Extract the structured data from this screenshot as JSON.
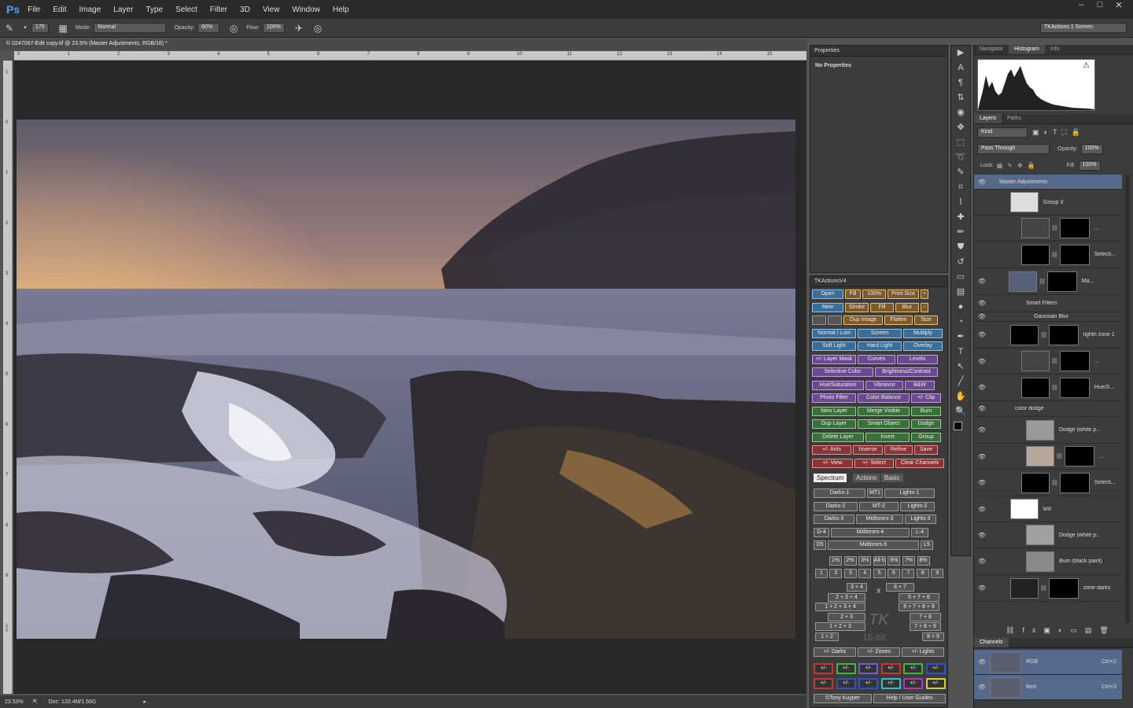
{
  "menubar": {
    "logo": "Ps",
    "items": [
      "File",
      "Edit",
      "Image",
      "Layer",
      "Type",
      "Select",
      "Filter",
      "3D",
      "View",
      "Window",
      "Help"
    ],
    "window_controls": [
      "–",
      "□",
      "✕"
    ]
  },
  "options": {
    "brush_size": "175",
    "mode_label": "Mode:",
    "mode_value": "Normal",
    "opacity_label": "Opacity:",
    "opacity_value": "60%",
    "flow_label": "Flow:",
    "flow_value": "100%",
    "workspace": "TKActions 1 Screen"
  },
  "document": {
    "tab_title": "© 0247067-Edit copy.tif @ 23.5% (Master Adjustments, RGB/16) *",
    "ruler_h": [
      "0",
      "1",
      "2",
      "3",
      "4",
      "5",
      "6",
      "7",
      "8",
      "9",
      "10",
      "11",
      "12",
      "13",
      "14",
      "15"
    ],
    "ruler_v": [
      "1",
      "0",
      "1",
      "2",
      "3",
      "4",
      "5",
      "6",
      "7",
      "8",
      "9",
      "1 0"
    ]
  },
  "status": {
    "zoom": "23.53%",
    "doc": "Doc: 120.4M/1.56G"
  },
  "properties": {
    "title": "Properties",
    "text": "No Properties"
  },
  "tkactions": {
    "title": "TKActionsV4",
    "rows": [
      [
        {
          "t": "Open",
          "c": "blu"
        },
        {
          "t": "Fill",
          "c": "brn"
        },
        {
          "t": "100%",
          "c": "brn"
        },
        {
          "t": "Print Size",
          "c": "brn"
        },
        {
          "t": "+",
          "c": "brn"
        }
      ],
      [
        {
          "t": "New",
          "c": "blu"
        },
        {
          "t": "Stroke",
          "c": "brn"
        },
        {
          "t": "Fill",
          "c": "brn"
        },
        {
          "t": "Blur",
          "c": "brn"
        },
        {
          "t": "-",
          "c": "brn"
        }
      ],
      [
        {
          "t": "",
          "c": "gry"
        },
        {
          "t": "",
          "c": "gry"
        },
        {
          "t": "Dup Image",
          "c": "brn"
        },
        {
          "t": "Flatten",
          "c": "brn"
        },
        {
          "t": "Size",
          "c": "brn"
        }
      ],
      [
        {
          "t": "Normal / Lum",
          "c": "blu"
        },
        {
          "t": "Screen",
          "c": "blu"
        },
        {
          "t": "Multiply",
          "c": "blu"
        }
      ],
      [
        {
          "t": "Soft Light",
          "c": "blu"
        },
        {
          "t": "Hard Light",
          "c": "blu"
        },
        {
          "t": "Overlay",
          "c": "blu"
        }
      ],
      [
        {
          "t": "+/- Layer Mask",
          "c": "pur"
        },
        {
          "t": "Curves",
          "c": "pur"
        },
        {
          "t": "Levels",
          "c": "pur"
        }
      ],
      [
        {
          "t": "Selective Color",
          "c": "pur"
        },
        {
          "t": "Brightness/Contrast",
          "c": "pur"
        }
      ],
      [
        {
          "t": "Hue/Saturation",
          "c": "pur"
        },
        {
          "t": "Vibrance",
          "c": "pur"
        },
        {
          "t": "B&W",
          "c": "pur"
        }
      ],
      [
        {
          "t": "Photo Filter",
          "c": "pur"
        },
        {
          "t": "Color Balance",
          "c": "pur"
        },
        {
          "t": "+/- Clip",
          "c": "pur"
        }
      ],
      [
        {
          "t": "New Layer",
          "c": "grn"
        },
        {
          "t": "Merge Visible",
          "c": "grn"
        },
        {
          "t": "Burn",
          "c": "grn"
        }
      ],
      [
        {
          "t": "Dup Layer",
          "c": "grn"
        },
        {
          "t": "Smart Object",
          "c": "grn"
        },
        {
          "t": "Dodge",
          "c": "grn"
        }
      ],
      [
        {
          "t": "Delete Layer",
          "c": "grn"
        },
        {
          "t": "Invert",
          "c": "grn"
        },
        {
          "t": "Group",
          "c": "grn"
        }
      ],
      [
        {
          "t": "+/- Ants",
          "c": "red"
        },
        {
          "t": "Inverse",
          "c": "red"
        },
        {
          "t": "Refine",
          "c": "red"
        },
        {
          "t": "Save",
          "c": "red"
        }
      ],
      [
        {
          "t": "+/- View",
          "c": "red"
        },
        {
          "t": "+/- Select",
          "c": "red"
        },
        {
          "t": "Clear Channels",
          "c": "red"
        }
      ]
    ],
    "tabs": [
      "Spectrum",
      "Actions",
      "Basic"
    ],
    "zones": [
      [
        "Darks-1",
        "MT1",
        "Lights-1"
      ],
      [
        "Darks-2",
        "MT-2",
        "Lights-2"
      ],
      [
        "Darks-3",
        "Midtones-3",
        "Lights-3"
      ],
      [
        "D-4",
        "Midtones-4",
        "L-4"
      ],
      [
        "D5",
        "Midtones-5",
        "L5"
      ]
    ],
    "pcts": [
      "1%",
      "2%",
      "3%",
      "All-5",
      "6%",
      "7%",
      "8%"
    ],
    "nums": [
      "1",
      "2",
      "3",
      "4",
      "5",
      "6",
      "7",
      "8",
      "9"
    ],
    "combos_left": [
      "3 + 4",
      "2 + 3 + 4",
      "1 + 2 + 3 + 4",
      "2 + 3",
      "1 + 2 + 3",
      "1 + 2"
    ],
    "combos_right": [
      "6 + 7",
      "6 + 7 + 8",
      "6 + 7 + 8 + 9",
      "7 + 8",
      "7 + 8 + 9",
      "8 + 9"
    ],
    "x_label": "X",
    "logo": "TK",
    "bit": "16-bit",
    "zone_btns": [
      "+/- Darks",
      "+/- Zones",
      "+/- Lights"
    ],
    "pm": "+/-",
    "pm_colors": [
      "#d23030",
      "#30c030",
      "#7a5ad0",
      "#d23030",
      "#30c030",
      "#3050d0",
      "#d23030",
      "#3050d0",
      "#3050d0",
      "#30c0d0",
      "#c030c0",
      "#d0d030"
    ],
    "footer": [
      "©Tony Kuyper",
      "Help / User Guides"
    ]
  },
  "navigator": {
    "tabs": [
      "Navigator",
      "Histogram",
      "Info"
    ],
    "active": 1
  },
  "layers": {
    "tabs": [
      "Layers",
      "Paths"
    ],
    "kind": "Kind",
    "blend": "Pass Through",
    "opacity_label": "Opacity:",
    "opacity": "100%",
    "lock_label": "Lock:",
    "fill_label": "Fill:",
    "fill": "100%",
    "rows": [
      {
        "name": "Master Adjustments"
      },
      {
        "name": "Group 3"
      },
      {
        "name": "..."
      },
      {
        "name": "Selecti..."
      },
      {
        "name": "Ma..."
      },
      {
        "name": "Smart Filters"
      },
      {
        "name": "Gaussian Blur"
      },
      {
        "name": "lightn zone 1"
      },
      {
        "name": "..."
      },
      {
        "name": "Hue/S..."
      },
      {
        "name": "color dodge"
      },
      {
        "name": "Dodge (white p..."
      },
      {
        "name": "..."
      },
      {
        "name": "Selecti..."
      },
      {
        "name": "b/d"
      },
      {
        "name": "Dodge (white p..."
      },
      {
        "name": "Burn (black paint)"
      },
      {
        "name": "zone darks"
      }
    ]
  },
  "channels": {
    "title": "Channels",
    "rows": [
      {
        "name": "RGB",
        "shortcut": "Ctrl+2"
      },
      {
        "name": "Red",
        "shortcut": "Ctrl+3"
      }
    ]
  }
}
